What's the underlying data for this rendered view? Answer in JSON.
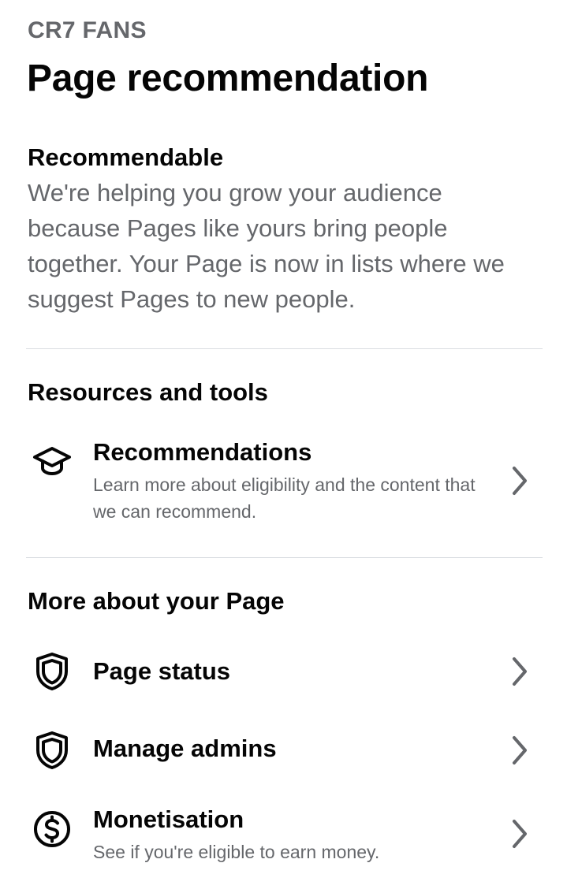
{
  "header": {
    "subtitle": "CR7 FANS",
    "title": "Page recommendation"
  },
  "recommendable": {
    "heading": "Recommendable",
    "body": "We're helping you grow your audience because Pages like yours bring people together. Your Page is now in lists where we suggest Pages to new people."
  },
  "resources": {
    "heading": "Resources and tools",
    "items": [
      {
        "icon": "graduation-cap-icon",
        "title": "Recommendations",
        "description": "Learn more about eligibility and the content that we can recommend."
      }
    ]
  },
  "more": {
    "heading": "More about your Page",
    "items": [
      {
        "icon": "shield-icon",
        "title": "Page status",
        "description": ""
      },
      {
        "icon": "shield-icon",
        "title": "Manage admins",
        "description": ""
      },
      {
        "icon": "dollar-circle-icon",
        "title": "Monetisation",
        "description": "See if you're eligible to earn money."
      }
    ]
  },
  "colors": {
    "primary_text": "#050505",
    "secondary_text": "#65676b",
    "divider": "#dadde1",
    "chevron": "#65676b"
  }
}
